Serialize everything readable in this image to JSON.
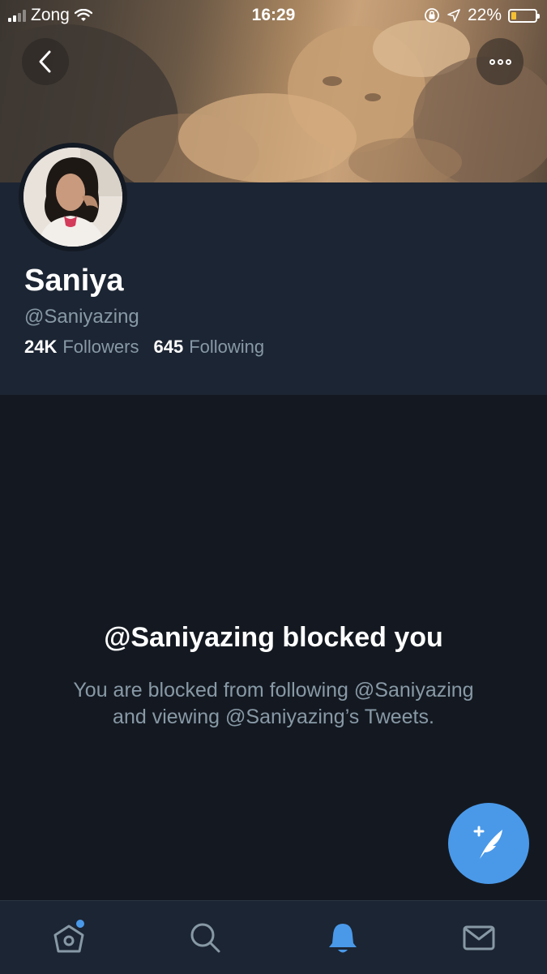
{
  "status_bar": {
    "carrier": "Zong",
    "time": "16:29",
    "battery": "22%",
    "battery_level": 0.22
  },
  "profile": {
    "display_name": "Saniya",
    "handle": "@Saniyazing",
    "followers_count": "24K",
    "followers_label": "Followers",
    "following_count": "645",
    "following_label": "Following"
  },
  "blocked": {
    "title": "@Saniyazing blocked you",
    "description_line1": "You are blocked from following @Saniyazing",
    "description_line2": "and viewing @Saniyazing’s Tweets."
  },
  "icons": {
    "back": "chevron-left-icon",
    "more": "more-dots-icon",
    "compose": "compose-tweet-icon",
    "home": "home-icon",
    "search": "search-icon",
    "notifications": "bell-icon",
    "messages": "mail-icon"
  },
  "colors": {
    "accent": "#4a99e9",
    "header_bg": "#1c2533",
    "body_bg": "#141921",
    "secondary_text": "#8899a6",
    "battery_fill": "#f5c033",
    "notification_dot": "#4a99e9"
  }
}
